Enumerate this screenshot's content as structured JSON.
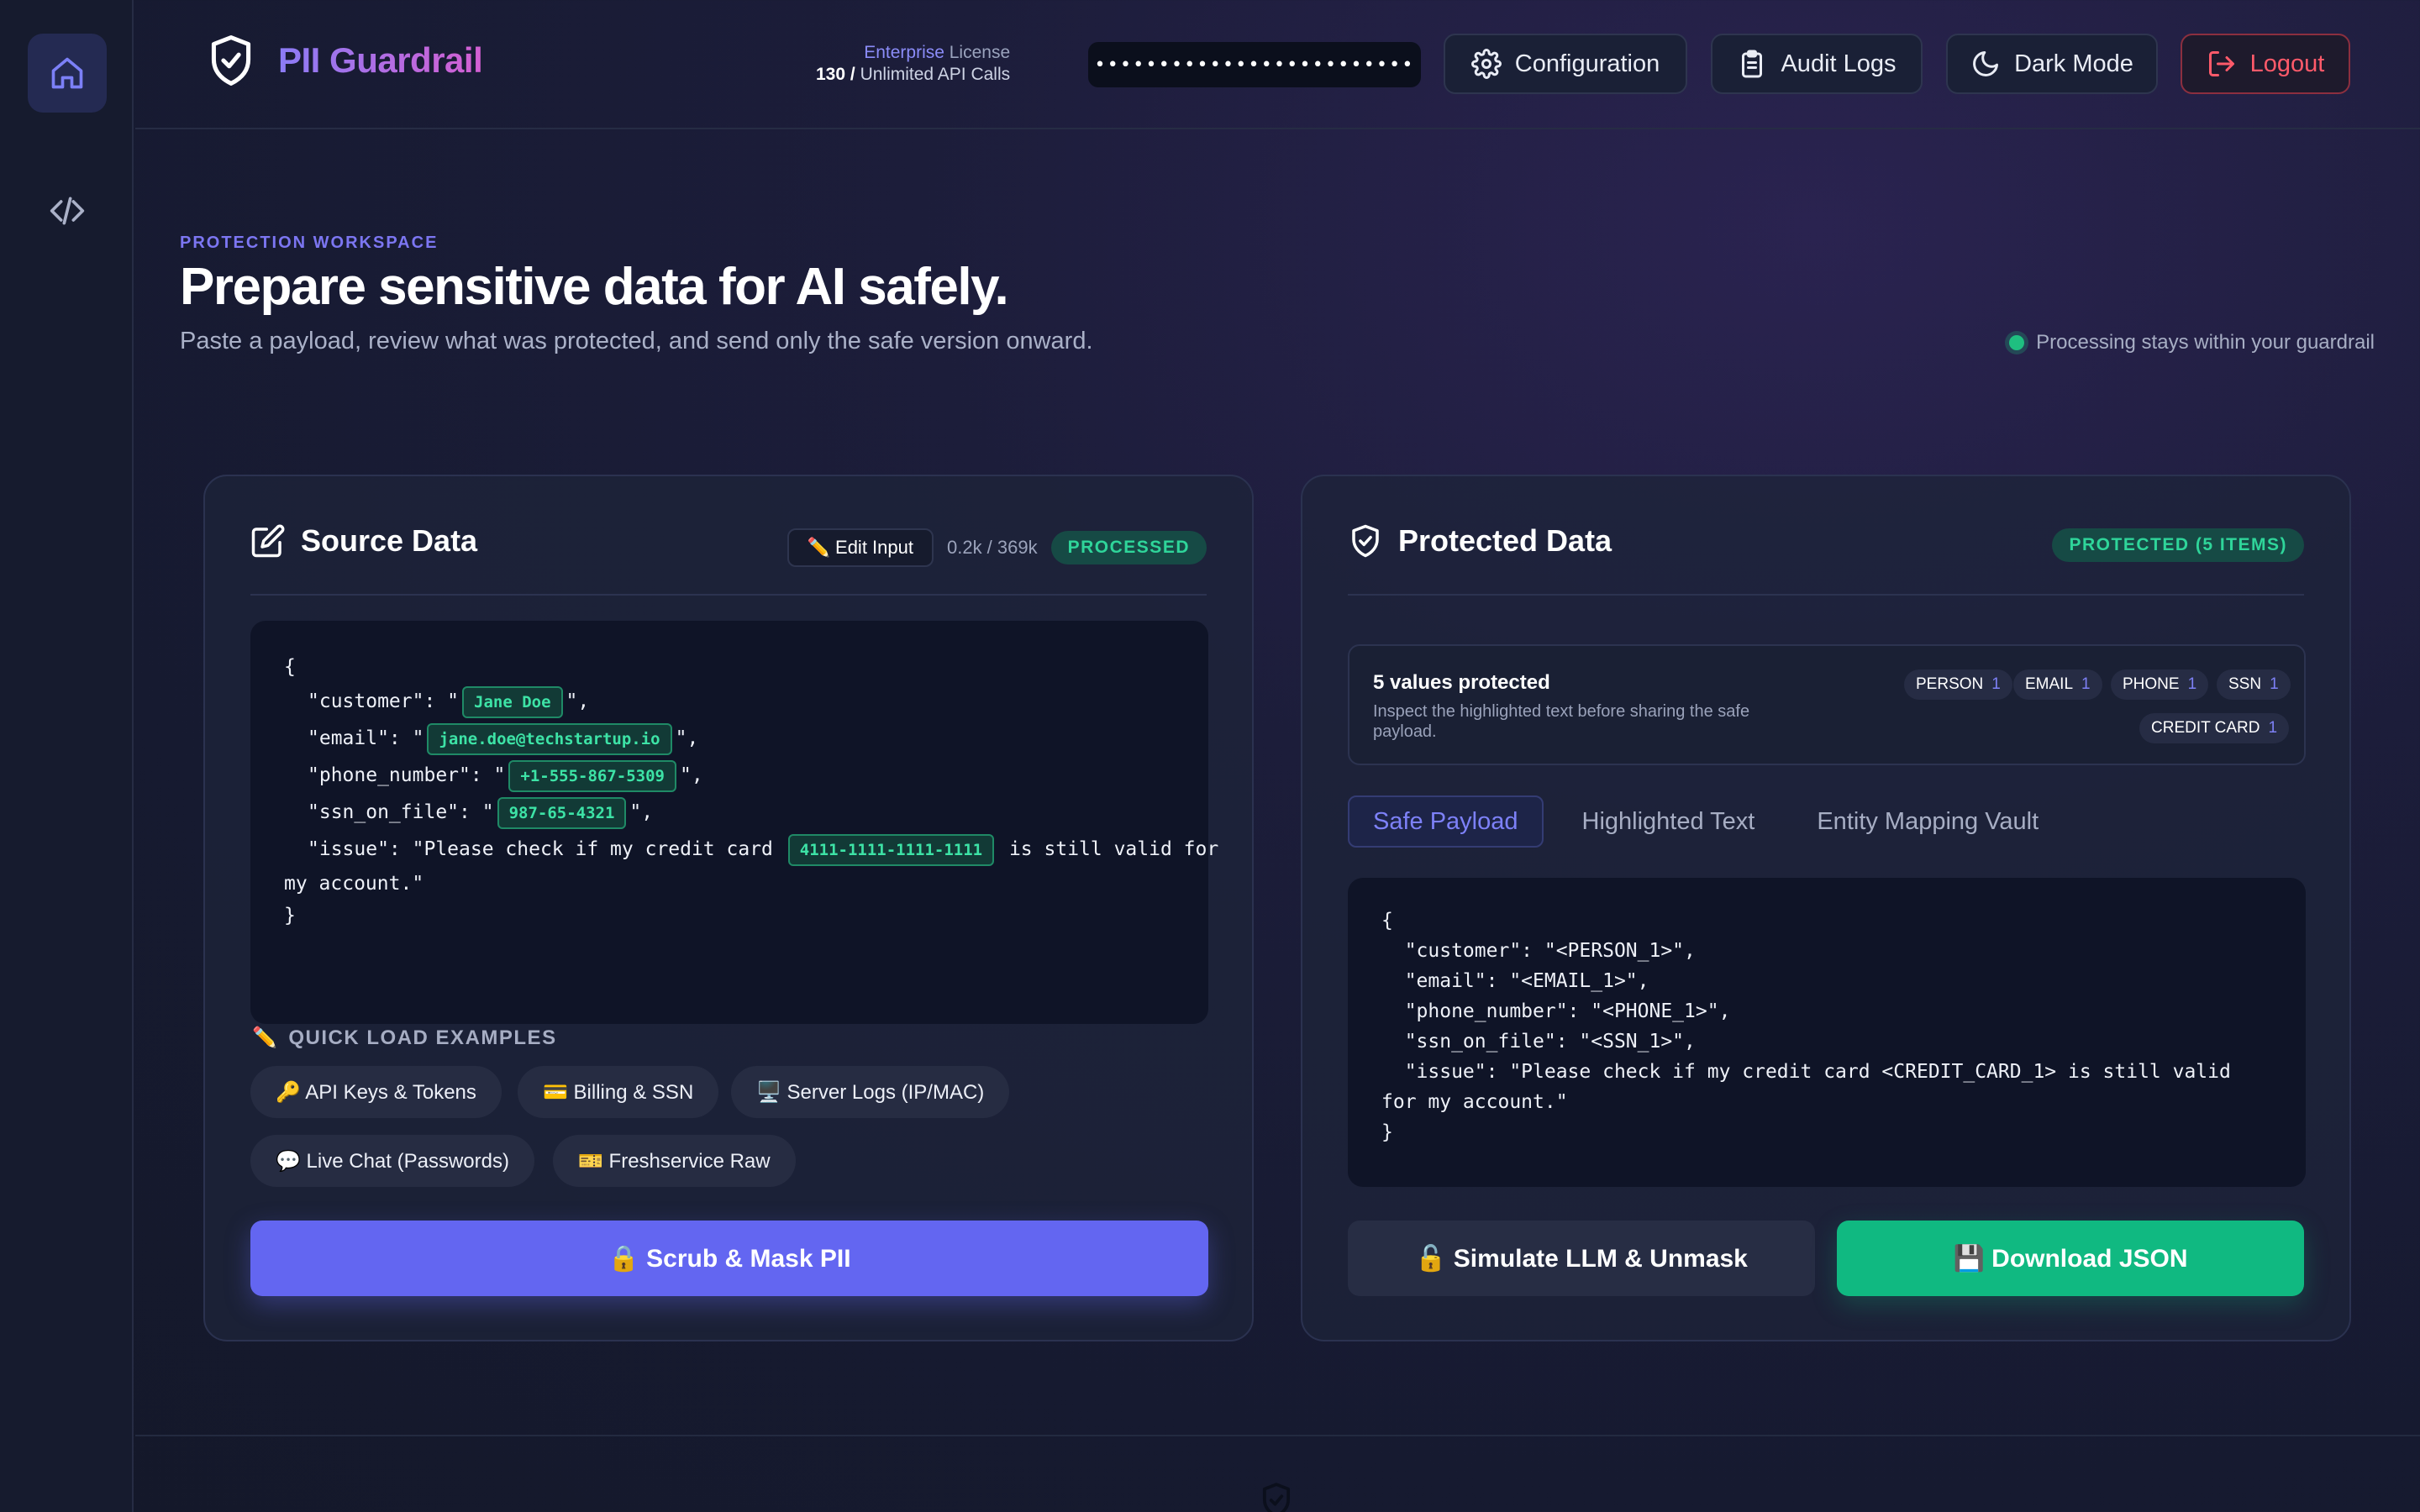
{
  "app": {
    "name": "PII Guardrail"
  },
  "license": {
    "tier": "Enterprise",
    "suffix": " License",
    "used": "130",
    "separator": " / ",
    "limit": "Unlimited",
    "calls_label": " API Calls"
  },
  "api_key": {
    "masked": "•••••••••••••••••••••••••"
  },
  "toolbar": {
    "configuration": "Configuration",
    "audit_logs": "Audit Logs",
    "dark_mode": "Dark Mode",
    "logout": "Logout"
  },
  "hero": {
    "eyebrow": "PROTECTION WORKSPACE",
    "title": "Prepare sensitive data for AI safely.",
    "subtitle": "Paste a payload, review what was protected, and send only the safe version onward.",
    "status": "Processing stays within your guardrail"
  },
  "source": {
    "title": "Source Data",
    "edit_label": "✏️ Edit Input",
    "char_count": "0.2k / 369k",
    "status": "PROCESSED",
    "lines": {
      "open": "{",
      "customer_key": "\"customer\": \"",
      "customer_val": "Jane Doe",
      "customer_end": "\",",
      "email_key": "\"email\": \"",
      "email_val": "jane.doe@techstartup.io",
      "email_end": "\",",
      "phone_key": "\"phone_number\": \"",
      "phone_val": "+1-555-867-5309",
      "phone_end": "\",",
      "ssn_key": "\"ssn_on_file\": \"",
      "ssn_val": "987-65-4321",
      "ssn_end": "\",",
      "issue_key": "\"issue\": \"Please check if my credit card",
      "issue_val": "4111-1111-1111-1111",
      "issue_end": "is still valid for",
      "issue_wrap": "my account.\"",
      "close": "}"
    },
    "quick_label": "QUICK LOAD EXAMPLES",
    "examples": [
      "🔑 API Keys & Tokens",
      "💳 Billing & SSN",
      "🖥️ Server Logs (IP/MAC)",
      "💬 Live Chat (Passwords)",
      "🎫 Freshservice Raw"
    ],
    "scrub_button": "🔒 Scrub & Mask PII"
  },
  "protected": {
    "title": "Protected Data",
    "status": "PROTECTED (5 ITEMS)",
    "summary_title": "5 values protected",
    "summary_desc": "Inspect the highlighted text before sharing the safe payload.",
    "entities": [
      {
        "label": "PERSON",
        "count": "1"
      },
      {
        "label": "EMAIL",
        "count": "1"
      },
      {
        "label": "PHONE",
        "count": "1"
      },
      {
        "label": "SSN",
        "count": "1"
      },
      {
        "label": "CREDIT CARD",
        "count": "1"
      }
    ],
    "tabs": [
      "Safe Payload",
      "Highlighted Text",
      "Entity Mapping Vault"
    ],
    "payload": [
      "{",
      "  \"customer\": \"<PERSON_1>\",",
      "  \"email\": \"<EMAIL_1>\",",
      "  \"phone_number\": \"<PHONE_1>\",",
      "  \"ssn_on_file\": \"<SSN_1>\",",
      "  \"issue\": \"Please check if my credit card <CREDIT_CARD_1> is still valid",
      "for my account.\"",
      "}"
    ],
    "simulate_button": "🔓 Simulate LLM & Unmask",
    "download_button": "💾 Download JSON"
  },
  "colors": {
    "accent": "#6366f1",
    "success": "#10b981",
    "danger": "#ff5a6a",
    "brand_start": "#8b7cf6",
    "brand_end": "#d45fd2"
  }
}
